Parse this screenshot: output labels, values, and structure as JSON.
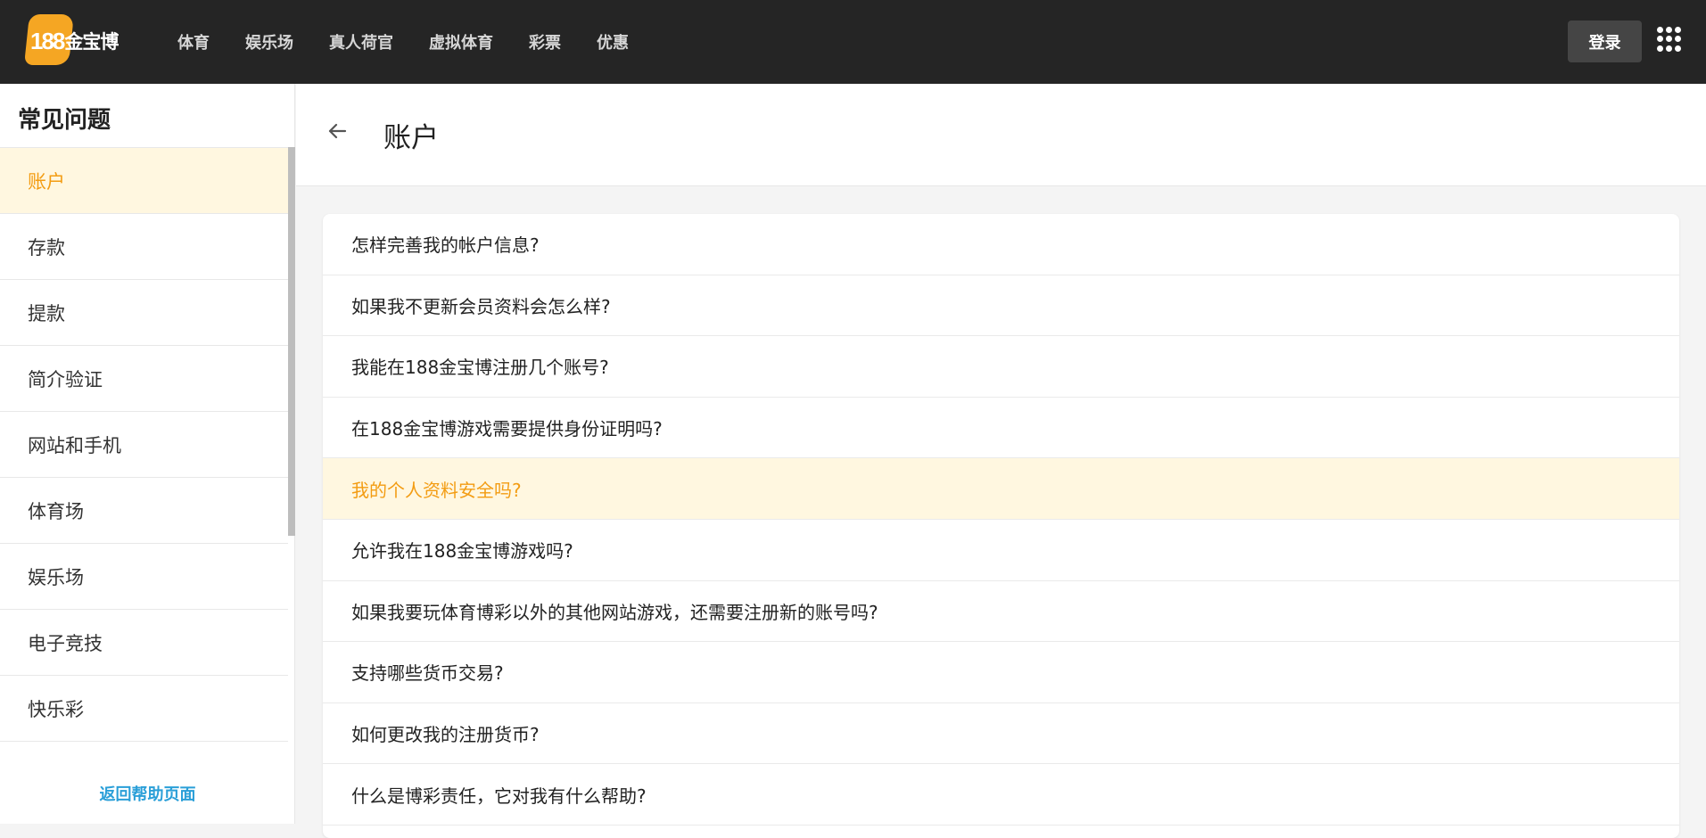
{
  "brand": {
    "logo_number": "188",
    "logo_text": "金宝博",
    "accent_color": "#f39c12"
  },
  "nav": {
    "items": [
      "体育",
      "娱乐场",
      "真人荷官",
      "虚拟体育",
      "彩票",
      "优惠"
    ],
    "login_label": "登录"
  },
  "sidebar": {
    "title": "常见问题",
    "items": [
      {
        "label": "账户",
        "active": true
      },
      {
        "label": "存款"
      },
      {
        "label": "提款"
      },
      {
        "label": "简介验证"
      },
      {
        "label": "网站和手机"
      },
      {
        "label": "体育场"
      },
      {
        "label": "娱乐场"
      },
      {
        "label": "电子竞技"
      },
      {
        "label": "快乐彩"
      }
    ],
    "back_link": "返回帮助页面"
  },
  "main": {
    "title": "账户",
    "faqs": [
      {
        "q": "怎样完善我的帐户信息?"
      },
      {
        "q": "如果我不更新会员资料会怎么样?"
      },
      {
        "q": "我能在188金宝博注册几个账号?"
      },
      {
        "q": "在188金宝博游戏需要提供身份证明吗?"
      },
      {
        "q": "我的个人资料安全吗?",
        "active": true
      },
      {
        "q": "允许我在188金宝博游戏吗?"
      },
      {
        "q": "如果我要玩体育博彩以外的其他网站游戏，还需要注册新的账号吗?"
      },
      {
        "q": "支持哪些货币交易?"
      },
      {
        "q": "如何更改我的注册货币?"
      },
      {
        "q": "什么是博彩责任，它对我有什么帮助?"
      }
    ]
  }
}
